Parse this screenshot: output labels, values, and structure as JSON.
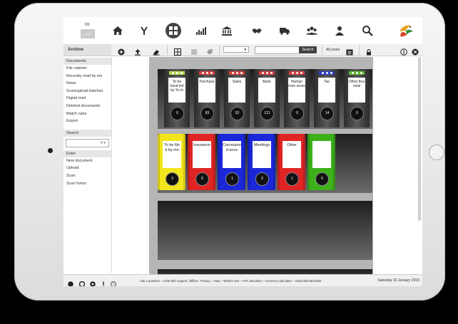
{
  "logo": {
    "top": "bb",
    "bottom": "LOGO"
  },
  "topnav": [
    {
      "name": "home-icon",
      "active": false
    },
    {
      "name": "y-icon",
      "active": false
    },
    {
      "name": "archive-icon",
      "active": true
    },
    {
      "name": "chart-icon",
      "active": false
    },
    {
      "name": "bank-icon",
      "active": false
    },
    {
      "name": "handshake-icon",
      "active": false
    },
    {
      "name": "truck-icon",
      "active": false
    },
    {
      "name": "group-icon",
      "active": false
    },
    {
      "name": "person-icon",
      "active": false
    },
    {
      "name": "search-icon",
      "active": false
    }
  ],
  "toolbar": {
    "section_title": "Archive",
    "select_value": "",
    "search_value": "",
    "search_button": "Search",
    "year_filter": "All years"
  },
  "sidebar": {
    "documents_header": "Documents",
    "documents": [
      "File cabinet",
      "Recently read by me",
      "News",
      "Scan/upload batches",
      "Digital mail",
      "Deleted documents",
      "Match rules",
      "Export"
    ],
    "search_header": "Search",
    "search_value": "",
    "enter_header": "Enter",
    "enter_items": [
      "New document",
      "Upload",
      "Scan",
      "Scan forms"
    ]
  },
  "shelf1": [
    {
      "label": "To be hand led by Yu ki",
      "count": "0",
      "tab_color": "#b7d94a"
    },
    {
      "label": "Purchase",
      "count": "83",
      "tab_color": "#d93b3b"
    },
    {
      "label": "Sales",
      "count": "52",
      "tab_color": "#d93b3b"
    },
    {
      "label": "Bank",
      "count": "121",
      "tab_color": "#d93b3b"
    },
    {
      "label": "Human reso urces",
      "count": "0",
      "tab_color": "#d93b3b"
    },
    {
      "label": "Tax",
      "count": "14",
      "tab_color": "#2a3fc7"
    },
    {
      "label": "Other fina ncial",
      "count": "0",
      "tab_color": "#5cb82e"
    }
  ],
  "shelf2": [
    {
      "label": "To be file d by me",
      "count": "3",
      "color": "#f2e51b"
    },
    {
      "label": "Insurance",
      "count": "0",
      "color": "#e02424"
    },
    {
      "label": "Correspond ence",
      "count": "1",
      "color": "#1a28d9"
    },
    {
      "label": "Meetings",
      "count": "0",
      "color": "#1a28d9"
    },
    {
      "label": "Other",
      "count": "1",
      "color": "#e02424"
    },
    {
      "label": "",
      "count": "0",
      "color": "#3db01a"
    }
  ],
  "footer": {
    "links": "Ask a question – Chat with support: Offline– Privacy – Help – What's new – VAT calculator – Currency calculator – Gebruikersactiviteit",
    "date": "Saturday 16 January 2016"
  },
  "colors": {
    "shelf_frame": "#b5b5b5",
    "binder_gray": "#4a4a4a",
    "accent_dark": "#444444"
  }
}
